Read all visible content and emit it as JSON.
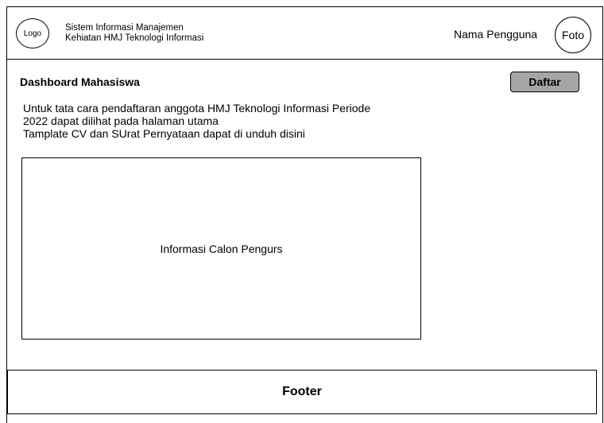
{
  "header": {
    "logo_label": "Logo",
    "app_title_line1": "Sistem Informasi Manajemen",
    "app_title_line2": "Kehiatan HMJ Teknologi Informasi",
    "user_name": "Nama Pengguna",
    "avatar_label": "Foto"
  },
  "main": {
    "page_title": "Dashboard Mahasiswa",
    "register_button_label": "Daftar",
    "info_lines": [
      "Untuk tata cara pendaftaran anggota HMJ Teknologi Informasi Periode",
      "2022 dapat dilihat pada halaman utama",
      "Tamplate CV dan SUrat Pernyataan dapat di unduh disini"
    ],
    "info_box_label": "Informasi Calon Pengurs"
  },
  "footer": {
    "label": "Footer"
  },
  "colors": {
    "button_fill": "#a6a6a6",
    "border": "#000000",
    "background": "#ffffff"
  }
}
